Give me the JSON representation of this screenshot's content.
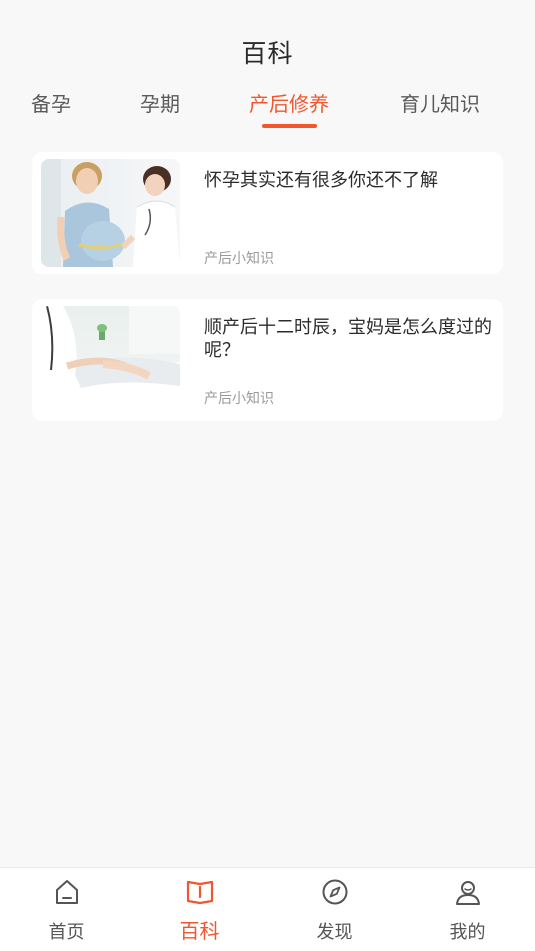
{
  "header": {
    "title": "百科"
  },
  "tabs": [
    {
      "label": "备孕"
    },
    {
      "label": "孕期"
    },
    {
      "label": "产后修养"
    },
    {
      "label": "育儿知识"
    }
  ],
  "active_tab": "产后修养",
  "articles": [
    {
      "title": "怀孕其实还有很多你还不了解",
      "tag": "产后小知识",
      "image": "pregnant-woman-with-doctor"
    },
    {
      "title": "顺产后十二时辰，宝妈是怎么度过的呢？",
      "tag": "产后小知识",
      "image": "mother-resting-in-hospital-bed"
    }
  ],
  "bottom_nav": [
    {
      "label": "首页",
      "icon": "home-icon"
    },
    {
      "label": "百科",
      "icon": "book-icon"
    },
    {
      "label": "发现",
      "icon": "compass-icon"
    },
    {
      "label": "我的",
      "icon": "user-icon"
    }
  ],
  "colors": {
    "accent": "#f0572e",
    "background": "#f8f8f8",
    "card": "#ffffff"
  }
}
